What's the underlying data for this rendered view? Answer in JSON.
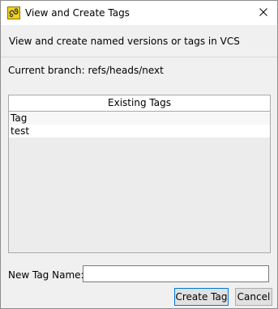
{
  "window": {
    "title": "View and Create Tags",
    "icon": "tag-app-icon",
    "close_icon": "close-icon"
  },
  "description": "View and create named versions or tags in VCS",
  "branch": "Current branch: refs/heads/next",
  "table": {
    "header": "Existing Tags",
    "rows": [
      "Tag",
      "test"
    ]
  },
  "form": {
    "new_tag_label": "New Tag Name:",
    "new_tag_value": "",
    "new_tag_placeholder": ""
  },
  "buttons": {
    "create": "Create Tag",
    "cancel": "Cancel"
  },
  "colors": {
    "accent": "#0078d7",
    "icon_yellow": "#f2d01b",
    "icon_dark": "#3a3a3a"
  }
}
